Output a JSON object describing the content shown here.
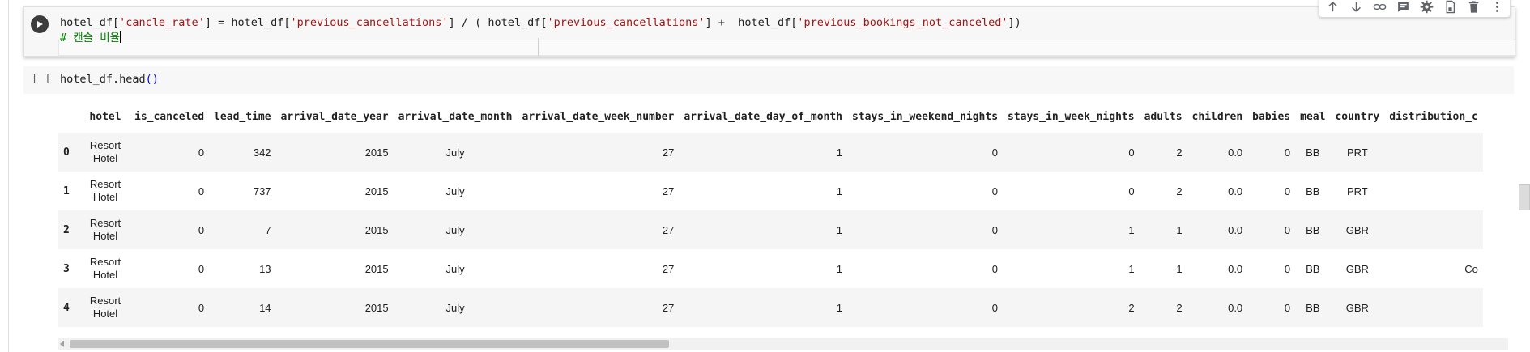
{
  "cell1": {
    "line1": [
      {
        "t": "hotel_df[",
        "c": "id"
      },
      {
        "t": "'cancle_rate'",
        "c": "str"
      },
      {
        "t": "] = hotel_df[",
        "c": "id"
      },
      {
        "t": "'previous_cancellations'",
        "c": "str"
      },
      {
        "t": "] / ( hotel_df[",
        "c": "id"
      },
      {
        "t": "'previous_cancellations'",
        "c": "str"
      },
      {
        "t": "] +  hotel_df[",
        "c": "id"
      },
      {
        "t": "'previous_bookings_not_canceled'",
        "c": "str"
      },
      {
        "t": "])",
        "c": "id"
      }
    ],
    "line2": "# 캔슬 비율"
  },
  "cell2": {
    "exec_count": "[ ]",
    "code_prefix": "hotel_df.head",
    "code_suffix": "()"
  },
  "table": {
    "columns": [
      "hotel",
      "is_canceled",
      "lead_time",
      "arrival_date_year",
      "arrival_date_month",
      "arrival_date_week_number",
      "arrival_date_day_of_month",
      "stays_in_weekend_nights",
      "stays_in_week_nights",
      "adults",
      "children",
      "babies",
      "meal",
      "country",
      "distribution_c"
    ],
    "rows": [
      {
        "index": "0",
        "cells": [
          "Resort Hotel",
          "0",
          "342",
          "2015",
          "July",
          "27",
          "1",
          "0",
          "0",
          "2",
          "0.0",
          "0",
          "BB",
          "PRT",
          ""
        ]
      },
      {
        "index": "1",
        "cells": [
          "Resort Hotel",
          "0",
          "737",
          "2015",
          "July",
          "27",
          "1",
          "0",
          "0",
          "2",
          "0.0",
          "0",
          "BB",
          "PRT",
          ""
        ]
      },
      {
        "index": "2",
        "cells": [
          "Resort Hotel",
          "0",
          "7",
          "2015",
          "July",
          "27",
          "1",
          "0",
          "1",
          "1",
          "0.0",
          "0",
          "BB",
          "GBR",
          ""
        ]
      },
      {
        "index": "3",
        "cells": [
          "Resort Hotel",
          "0",
          "13",
          "2015",
          "July",
          "27",
          "1",
          "0",
          "1",
          "1",
          "0.0",
          "0",
          "BB",
          "GBR",
          "Co"
        ]
      },
      {
        "index": "4",
        "cells": [
          "Resort Hotel",
          "0",
          "14",
          "2015",
          "July",
          "27",
          "1",
          "0",
          "2",
          "2",
          "0.0",
          "0",
          "BB",
          "GBR",
          ""
        ]
      }
    ]
  },
  "toolbar_icons": [
    "arrow-up-icon",
    "arrow-down-icon",
    "link-icon",
    "comment-icon",
    "settings-icon",
    "mirror-cell-icon",
    "delete-icon",
    "more-vert-icon"
  ]
}
